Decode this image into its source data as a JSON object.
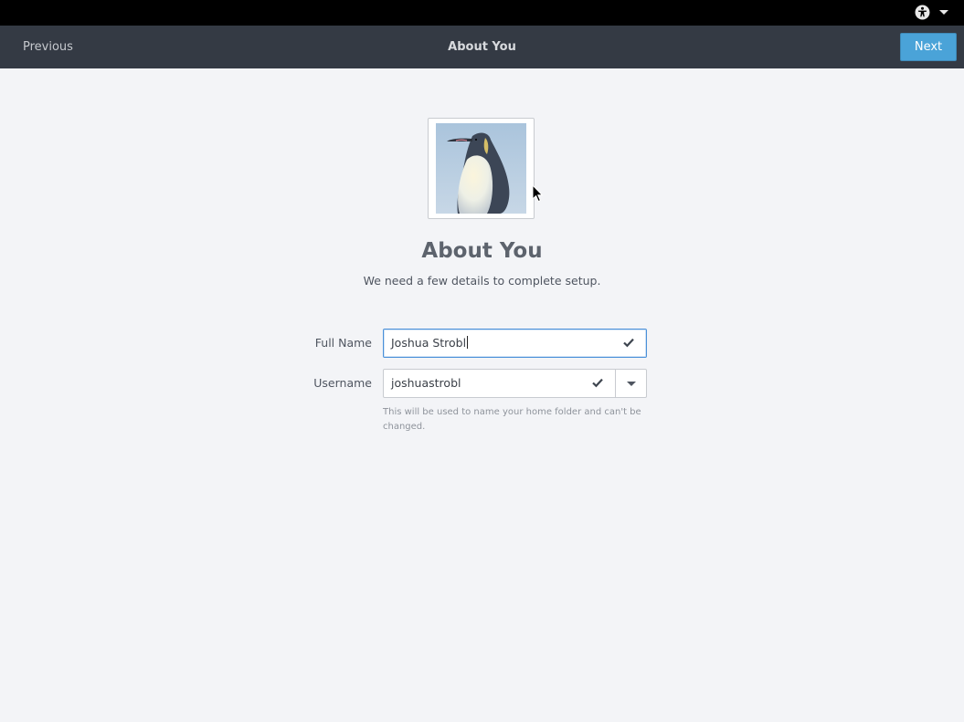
{
  "topbar": {
    "accessibility_icon": "accessibility-icon",
    "menu_icon": "chevron-down-icon"
  },
  "header": {
    "previous_label": "Previous",
    "title": "About You",
    "next_label": "Next"
  },
  "avatar": {
    "image": "penguin-photo"
  },
  "main": {
    "title": "About You",
    "subtitle": "We need a few details to complete setup."
  },
  "form": {
    "full_name_label": "Full Name",
    "full_name_value": "Joshua Strobl",
    "username_label": "Username",
    "username_value": "joshuastrobl",
    "username_hint": "This will be used to name your home folder and can't be changed.",
    "valid_icon": "checkmark-icon"
  },
  "colors": {
    "topbar": "#000000",
    "headerbar": "#343a44",
    "accent": "#4aa3d8",
    "background": "#f3f4f7",
    "focus_border": "#4a90d9"
  }
}
